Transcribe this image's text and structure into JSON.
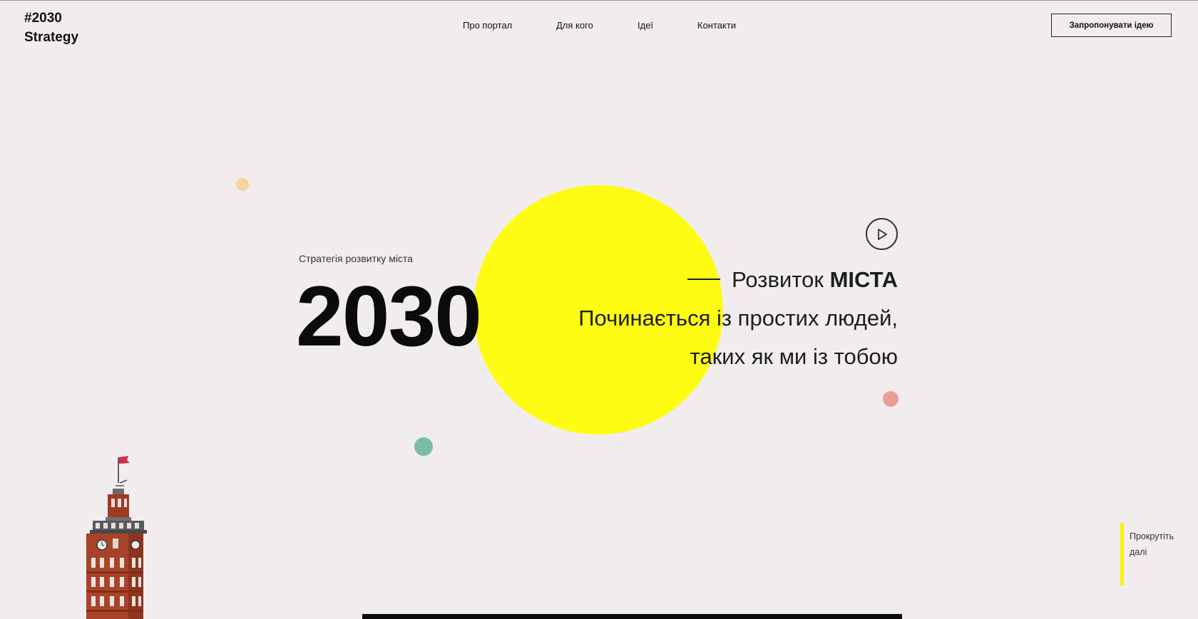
{
  "header": {
    "logo_line1": "#2030",
    "logo_line2": "Strategy",
    "nav": [
      {
        "label": "Про портал"
      },
      {
        "label": "Для кого"
      },
      {
        "label": "Ідеї"
      },
      {
        "label": "Контакти"
      }
    ],
    "cta_label": "Запропонувати ідею"
  },
  "hero": {
    "subtitle": "Стратегія розвитку міста",
    "year": "2030",
    "tagline_1_light": "Розвиток ",
    "tagline_1_bold": "МІСТА",
    "tagline_2": "Починається із простих людей,",
    "tagline_3": "таких як ми із тобою",
    "play_icon": "play-icon"
  },
  "scroll_hint": {
    "line1": "Прокрутіть",
    "line2": "далі"
  },
  "colors": {
    "background": "#f1edee",
    "accent_yellow": "#fefc13",
    "dot_peach": "#f4d4a0",
    "dot_green": "#7bbca7",
    "dot_pink": "#eb9e97",
    "scroll_bar": "#fbf200"
  }
}
